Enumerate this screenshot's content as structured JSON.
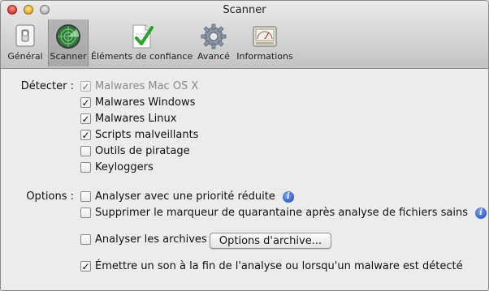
{
  "window": {
    "title": "Scanner"
  },
  "toolbar": {
    "items": [
      {
        "label": "Général",
        "icon": "switch-icon"
      },
      {
        "label": "Scanner",
        "icon": "radar-icon",
        "selected": true
      },
      {
        "label": "Éléments de confiance",
        "icon": "document-check-icon"
      },
      {
        "label": "Avancé",
        "icon": "gear-icon"
      },
      {
        "label": "Informations",
        "icon": "gauge-icon"
      }
    ]
  },
  "detect": {
    "label": "Détecter :",
    "items": [
      {
        "label": "Malwares Mac OS X",
        "checked": true,
        "disabled": true
      },
      {
        "label": "Malwares Windows",
        "checked": true
      },
      {
        "label": "Malwares Linux",
        "checked": true
      },
      {
        "label": "Scripts malveillants",
        "checked": true
      },
      {
        "label": "Outils de piratage",
        "checked": false
      },
      {
        "label": "Keyloggers",
        "checked": false
      }
    ]
  },
  "options": {
    "label": "Options :",
    "low_priority": {
      "label": "Analyser avec une priorité réduite",
      "checked": false
    },
    "quarantine": {
      "label": "Supprimer le marqueur de quarantaine après analyse de fichiers sains",
      "checked": false
    },
    "archives": {
      "label": "Analyser les archives",
      "checked": false
    },
    "archive_options_button": "Options d'archive...",
    "sound": {
      "label": "Émettre un son à la fin de l'analyse ou lorsqu'un malware est détecté",
      "checked": true
    }
  },
  "colors": {
    "info_blue": "#2f5fd6",
    "radar_green": "#2f7d3a",
    "check_green": "#29a329"
  }
}
